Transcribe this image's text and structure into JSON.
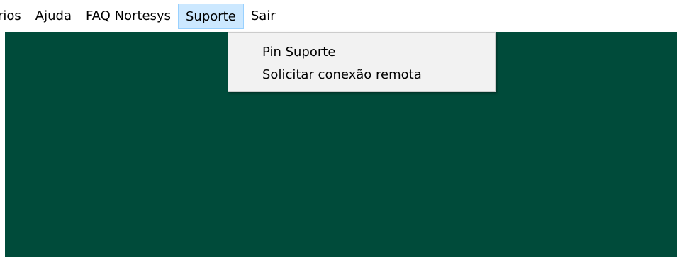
{
  "menubar": {
    "items": [
      {
        "label": "rios"
      },
      {
        "label": "Ajuda"
      },
      {
        "label": "FAQ Nortesys"
      },
      {
        "label": "Suporte"
      },
      {
        "label": "Sair"
      }
    ],
    "active_item": "Suporte"
  },
  "dropdown": {
    "items": [
      {
        "label": "Pin Suporte"
      },
      {
        "label": "Solicitar conexão remota"
      }
    ]
  },
  "colors": {
    "workspace_background": "#004b3a",
    "menu_highlight": "#cce8ff",
    "menu_highlight_border": "#99d1ff",
    "dropdown_background": "#f2f2f2"
  }
}
